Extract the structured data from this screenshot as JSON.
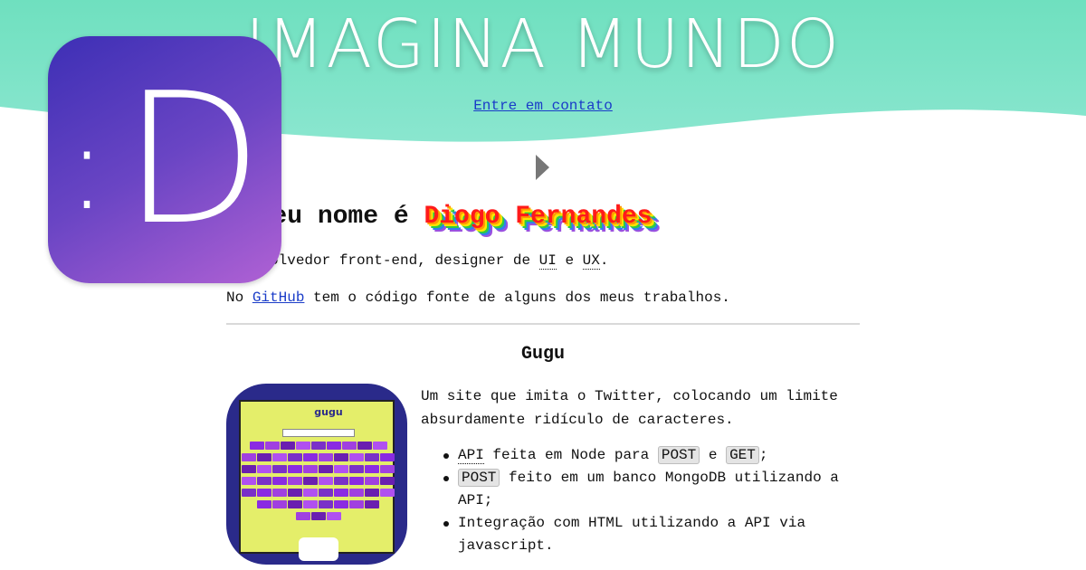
{
  "header": {
    "site_title": "IMAGINA MUNDO",
    "contact_link": "Entre em contato",
    "bg_color_top": "#6fe0bf",
    "bg_color_bottom": "#8ae6cf"
  },
  "logo": {
    "colon": ":",
    "letter": "D",
    "gradient_start": "#3d2fb5",
    "gradient_end": "#b061d4"
  },
  "greeting": {
    "prefix": ", meu nome é ",
    "name": "Diogo Fernandes"
  },
  "intro": {
    "text_start": "esenvolvedor front-end, designer de ",
    "ui": "UI",
    "connector": " e ",
    "ux": "UX",
    "end": "."
  },
  "github": {
    "prefix": "No ",
    "link": "GitHub",
    "suffix": " tem o código fonte de alguns dos meus trabalhos."
  },
  "project": {
    "title": "Gugu",
    "description": "Um site que imita o Twitter, colocando um limite absurdamente ridículo de caracteres.",
    "thumb_logo": "gugu",
    "features": [
      {
        "parts": [
          "API",
          " feita em Node para ",
          "POST",
          " e ",
          "GET",
          ";"
        ]
      },
      {
        "parts": [
          "POST",
          " feito em um banco MongoDB utilizando a API;"
        ]
      },
      {
        "parts": [
          "Integração com HTML utilizando a API via javascript."
        ]
      }
    ]
  }
}
